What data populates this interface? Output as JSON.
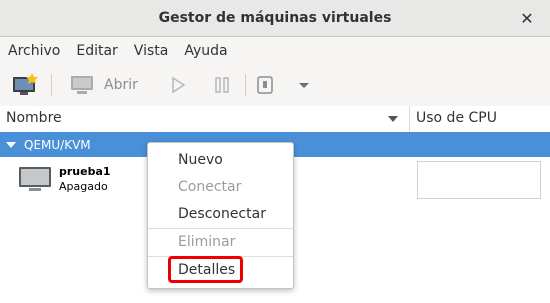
{
  "window": {
    "title": "Gestor de máquinas virtuales",
    "close_icon": "close-icon"
  },
  "menubar": {
    "items": [
      "Archivo",
      "Editar",
      "Vista",
      "Ayuda"
    ]
  },
  "toolbar": {
    "new_vm_icon": "new-vm-icon",
    "open_icon": "monitor-icon",
    "open_label": "Abrir",
    "run_icon": "play-icon",
    "pause_icon": "pause-icon",
    "shutdown_icon": "power-icon",
    "dropdown_icon": "chevron-down-icon"
  },
  "columns": {
    "name": "Nombre",
    "cpu": "Uso de CPU"
  },
  "connection": {
    "label": "QEMU/KVM"
  },
  "vm": {
    "name": "prueba1",
    "status": "Apagado",
    "icon": "monitor-icon"
  },
  "context_menu": {
    "new": "Nuevo",
    "connect": "Conectar",
    "disconnect": "Desconectar",
    "delete": "Eliminar",
    "details": "Detalles"
  },
  "colors": {
    "selection": "#4a90d9",
    "highlight": "#ee0000"
  }
}
